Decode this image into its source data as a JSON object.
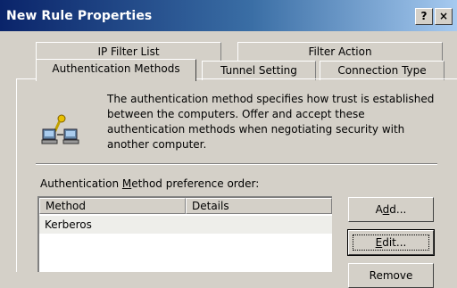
{
  "window": {
    "title": "New Rule Properties",
    "help_label": "?",
    "close_label": "×"
  },
  "tabs": {
    "back_row": [
      "IP Filter List",
      "Filter Action"
    ],
    "front_row": [
      "Authentication Methods",
      "Tunnel Setting",
      "Connection Type"
    ],
    "active": "Authentication Methods"
  },
  "description": "The authentication method specifies how trust is established between the computers. Offer and accept these authentication methods when negotiating security with another computer.",
  "preference": {
    "label_prefix": "Authentication ",
    "label_accel": "M",
    "label_suffix": "ethod preference order:"
  },
  "list": {
    "columns": [
      "Method",
      "Details"
    ],
    "rows": [
      {
        "method": "Kerberos",
        "details": ""
      }
    ]
  },
  "buttons": {
    "add_prefix": "A",
    "add_accel": "d",
    "add_suffix": "d...",
    "edit_accel": "E",
    "edit_suffix": "dit...",
    "remove_label": "Remove"
  },
  "icons": {
    "auth": "authentication-computers-icon"
  }
}
